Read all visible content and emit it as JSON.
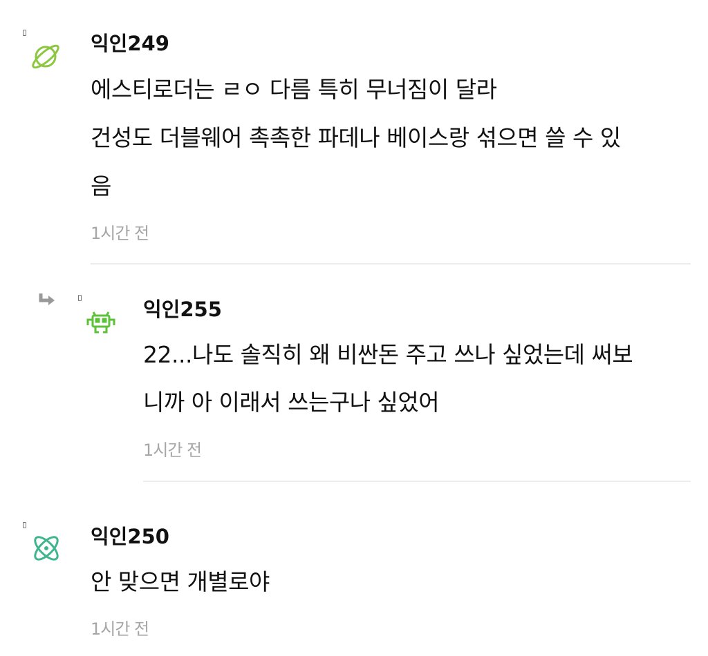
{
  "comments": [
    {
      "author": "익인249",
      "avatar_icon": "planet-icon",
      "avatar_color": "#8dc63f",
      "lines": [
        "에스티로더는 ㄹㅇ 다름 특히 무너짐이 달라",
        "건성도 더블웨어 촉촉한 파데나 베이스랑 섞으면 쓸 수 있",
        "음"
      ],
      "time": "1시간 전"
    },
    {
      "author": "익인255",
      "avatar_icon": "space-invader-icon",
      "avatar_color": "#5cc23a",
      "is_reply": true,
      "reply_icon": "reply-arrow-icon",
      "lines": [
        "22...나도 솔직히 왜 비싼돈 주고 쓰나 싶었는데 써보",
        "니까 아 이래서 쓰는구나 싶었어"
      ],
      "time": "1시간 전"
    },
    {
      "author": "익인250",
      "avatar_icon": "atom-icon",
      "avatar_color": "#3fb58e",
      "lines": [
        "안 맞으면 개별로야"
      ],
      "time": "1시간 전"
    }
  ]
}
